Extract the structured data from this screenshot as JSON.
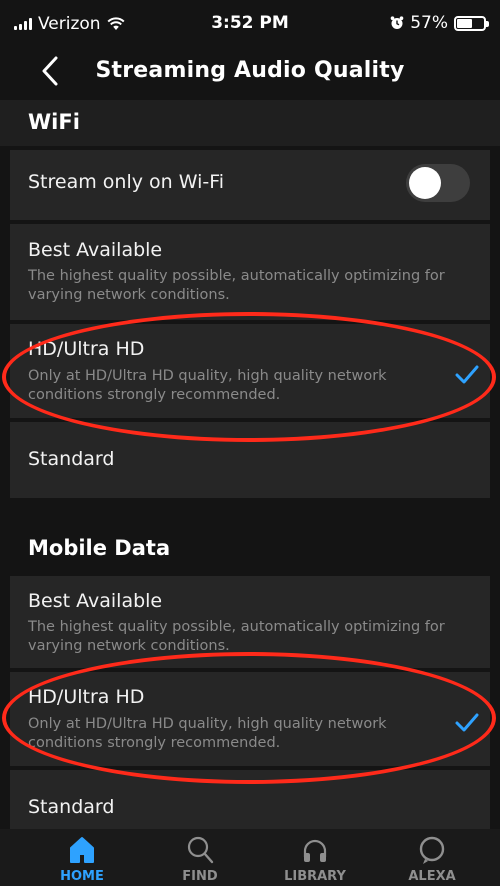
{
  "status_bar": {
    "carrier": "Verizon",
    "time": "3:52 PM",
    "battery": "57%",
    "battery_level": 0.57
  },
  "header": {
    "title": "Streaming Audio Quality"
  },
  "wifi": {
    "section_title": "WiFi",
    "stream_only_label": "Stream only on Wi-Fi",
    "stream_only_enabled": false,
    "options": [
      {
        "label": "Best Available",
        "desc": "The highest quality possible, automatically optimizing for varying network conditions.",
        "selected": false
      },
      {
        "label": "HD/Ultra HD",
        "desc": "Only at HD/Ultra HD quality, high quality network conditions strongly recommended.",
        "selected": true
      },
      {
        "label": "Standard",
        "selected": false
      }
    ]
  },
  "mobile": {
    "section_title": "Mobile Data",
    "options": [
      {
        "label": "Best Available",
        "desc": "The highest quality possible, automatically optimizing for varying network conditions.",
        "selected": false
      },
      {
        "label": "HD/Ultra HD",
        "desc": "Only at HD/Ultra HD quality, high quality network conditions strongly recommended.",
        "selected": true
      },
      {
        "label": "Standard",
        "selected": false
      }
    ]
  },
  "tabs": [
    {
      "label": "HOME",
      "icon": "home-icon",
      "active": true
    },
    {
      "label": "FIND",
      "icon": "search-icon",
      "active": false
    },
    {
      "label": "LIBRARY",
      "icon": "headphones-icon",
      "active": false
    },
    {
      "label": "ALEXA",
      "icon": "alexa-icon",
      "active": false
    }
  ],
  "colors": {
    "accent": "#2ea2ff",
    "annotation": "#ff2a1a",
    "background": "#141414"
  }
}
